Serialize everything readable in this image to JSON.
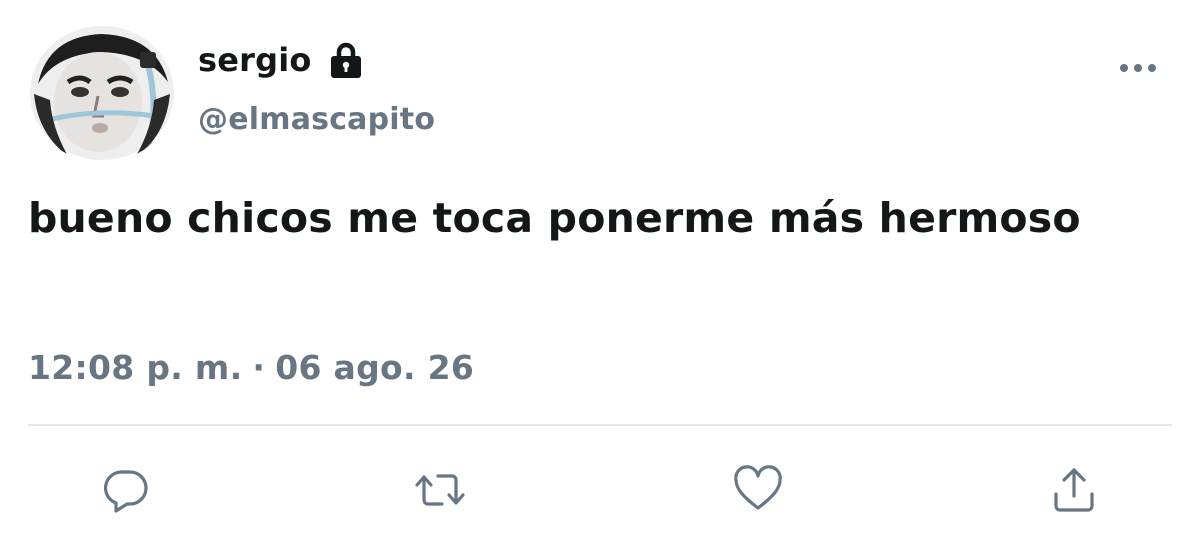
{
  "user": {
    "display_name": "sergio",
    "handle": "@elmascapito",
    "protected": true,
    "avatar": "avatar-image"
  },
  "tweet": {
    "text": "bueno chicos me toca ponerme más hermoso",
    "time": "12:08 p. m.",
    "separator": "·",
    "date": "06 ago. 26"
  },
  "icons": {
    "lock": "lock-icon",
    "more": "more-horizontal-icon",
    "reply": "reply-icon",
    "retweet": "retweet-icon",
    "like": "heart-icon",
    "share": "share-icon"
  },
  "colors": {
    "primary_text": "#14171a",
    "secondary_text": "#687684",
    "divider": "#e3e8ec",
    "icon": "#687684"
  }
}
